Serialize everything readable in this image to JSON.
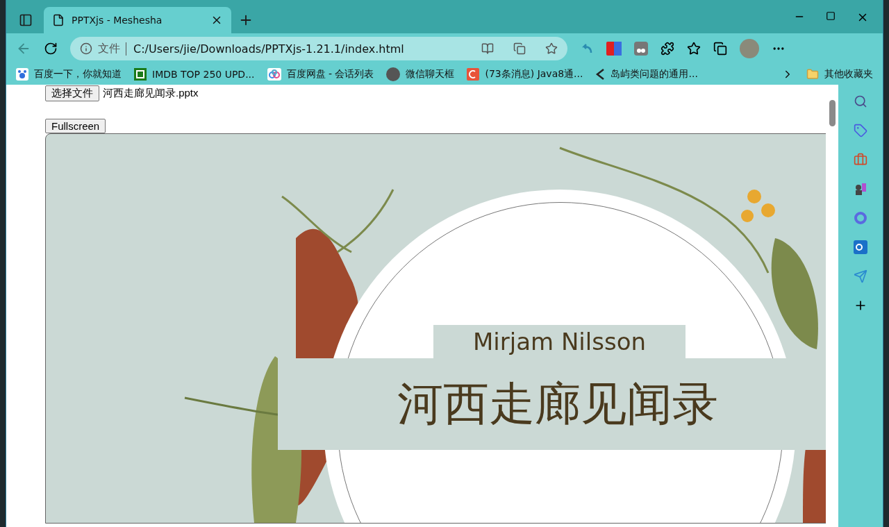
{
  "tabs": [
    {
      "title": "PPTXjs - Meshesha",
      "selected": true
    }
  ],
  "address_bar": {
    "security_label": "文件",
    "url": "C:/Users/jie/Downloads/PPTXjs-1.21.1/index.html"
  },
  "bookmarks": [
    {
      "label": "百度一下，你就知道",
      "kind": "paw"
    },
    {
      "label": "IMDB TOP 250 UPD...",
      "kind": "square"
    },
    {
      "label": "百度网盘 - 会话列表",
      "kind": "cloud"
    },
    {
      "label": "微信聊天框",
      "kind": "avatar"
    },
    {
      "label": "(73条消息) Java8通...",
      "kind": "tile"
    },
    {
      "label": "岛屿类问题的通用...",
      "kind": "chevron"
    }
  ],
  "bookmarks_folder": "其他收藏夹",
  "page": {
    "file_button": "选择文件",
    "file_name": "河西走廊见闻录.pptx",
    "fullscreen_button": "Fullscreen",
    "slide": {
      "subtitle": "Mirjam Nilsson",
      "title": "河西走廊见闻录"
    }
  }
}
